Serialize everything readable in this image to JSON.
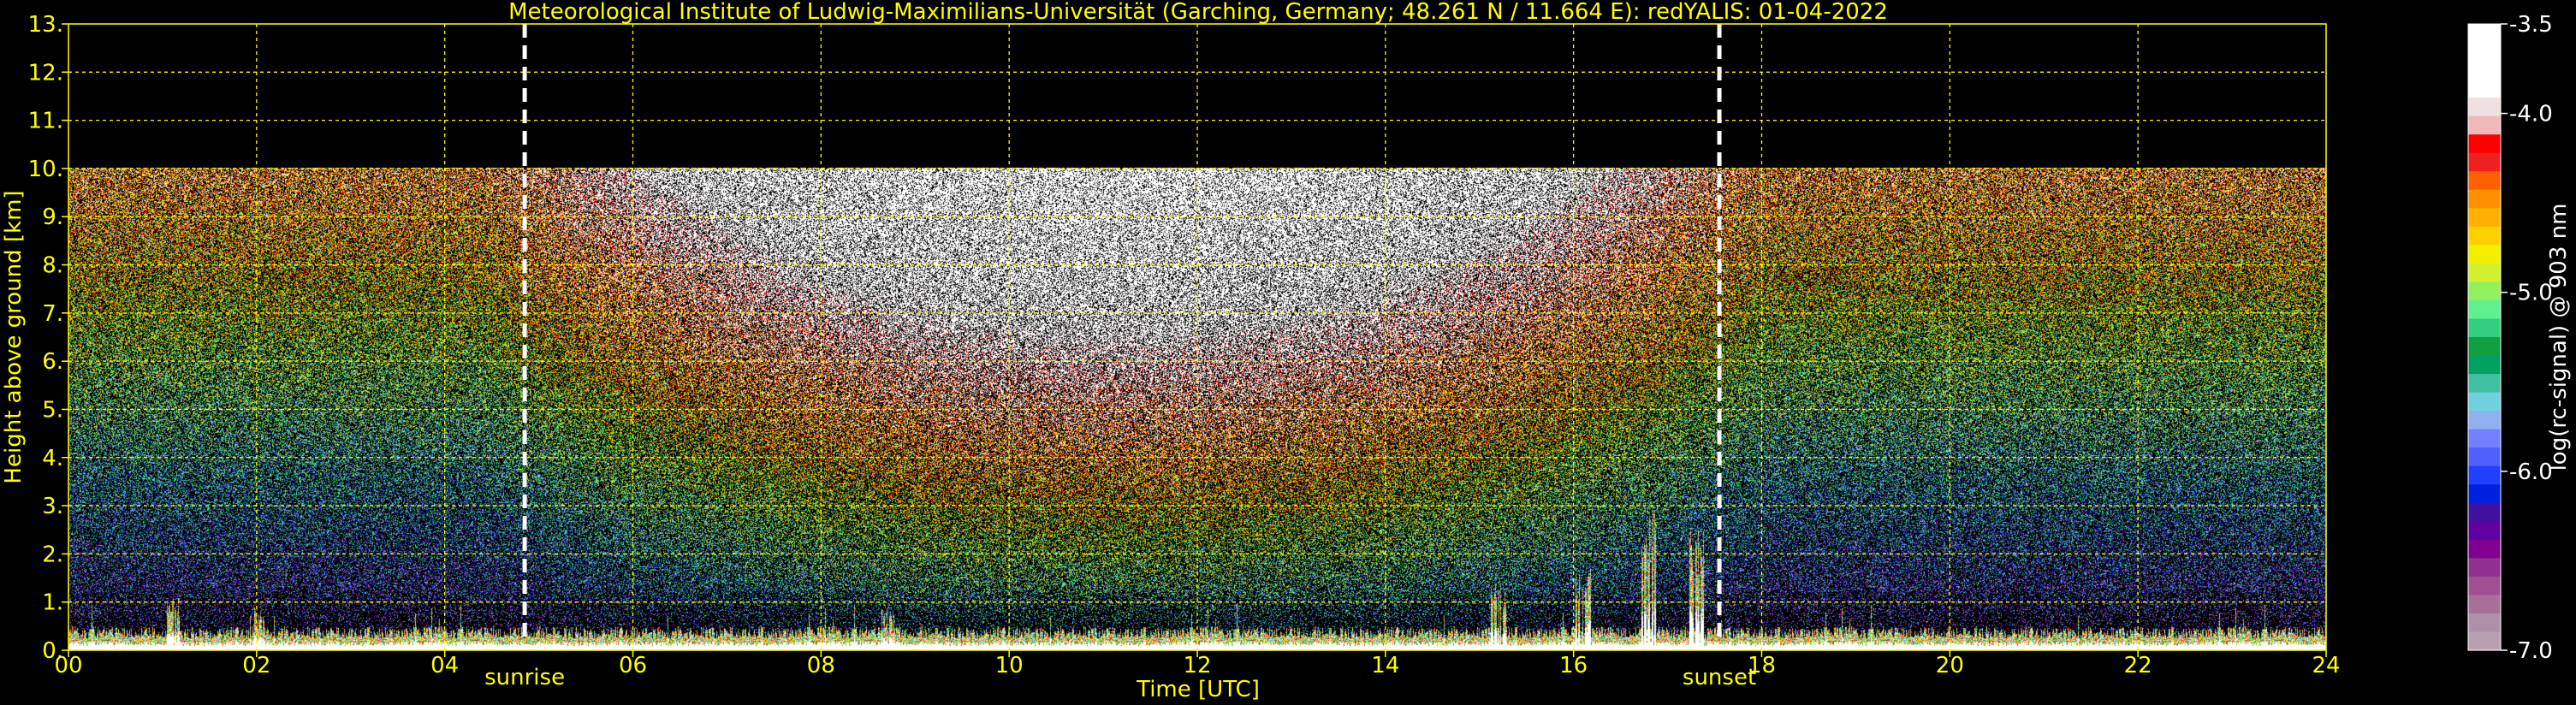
{
  "chart_data": {
    "type": "heatmap",
    "title": "Meteorological Institute of Ludwig-Maximilians-Universität (Garching, Germany; 48.261 N / 11.664 E):    redYALIS: 01-04-2022",
    "xlabel": "Time [UTC]",
    "ylabel": "Height above ground [km]",
    "xlim": [
      0,
      24
    ],
    "ylim": [
      0,
      13
    ],
    "x_ticks": [
      "00",
      "02",
      "04",
      "06",
      "08",
      "10",
      "12",
      "14",
      "16",
      "18",
      "20",
      "22",
      "24"
    ],
    "y_ticks": [
      "0.",
      "1.",
      "2.",
      "3.",
      "4.",
      "5.",
      "6.",
      "7.",
      "8.",
      "9.",
      "10.",
      "11.",
      "12.",
      "13."
    ],
    "grid": true,
    "signal_top_km": 10,
    "markers": [
      {
        "label": "sunrise",
        "x": 4.85
      },
      {
        "label": "sunset",
        "x": 17.55
      }
    ],
    "colorbar": {
      "label": "log(rc-signal) @ 903 nm",
      "range": [
        -7.0,
        -3.5
      ],
      "ticks": [
        "-3.5",
        "-4.0",
        "-5.0",
        "-6.0",
        "-7.0"
      ],
      "colors": [
        "#ffffff",
        "#ffffff",
        "#ffffff",
        "#ffffff",
        "#f0e0e0",
        "#f0b8b8",
        "#ff0000",
        "#f02020",
        "#ff6000",
        "#ff9000",
        "#ffb000",
        "#ffd000",
        "#f0f000",
        "#d0f030",
        "#90f060",
        "#60f090",
        "#30d080",
        "#10a040",
        "#00a060",
        "#40c0a0",
        "#70d0e0",
        "#90b0f0",
        "#7080ff",
        "#5060ff",
        "#2040ff",
        "#0020e0",
        "#4010a0",
        "#6000a0",
        "#800090",
        "#903090",
        "#a05090",
        "#a87098",
        "#b090a8",
        "#b8a0b0"
      ]
    },
    "lower_layer_km": 0.5,
    "cloud_events": [
      {
        "x": 1.1,
        "h": 1.1
      },
      {
        "x": 2.0,
        "h": 0.9
      },
      {
        "x": 8.7,
        "h": 0.9
      },
      {
        "x": 15.2,
        "h": 1.4
      },
      {
        "x": 16.1,
        "h": 1.7
      },
      {
        "x": 16.8,
        "h": 3.0
      },
      {
        "x": 17.3,
        "h": 2.6
      }
    ]
  }
}
